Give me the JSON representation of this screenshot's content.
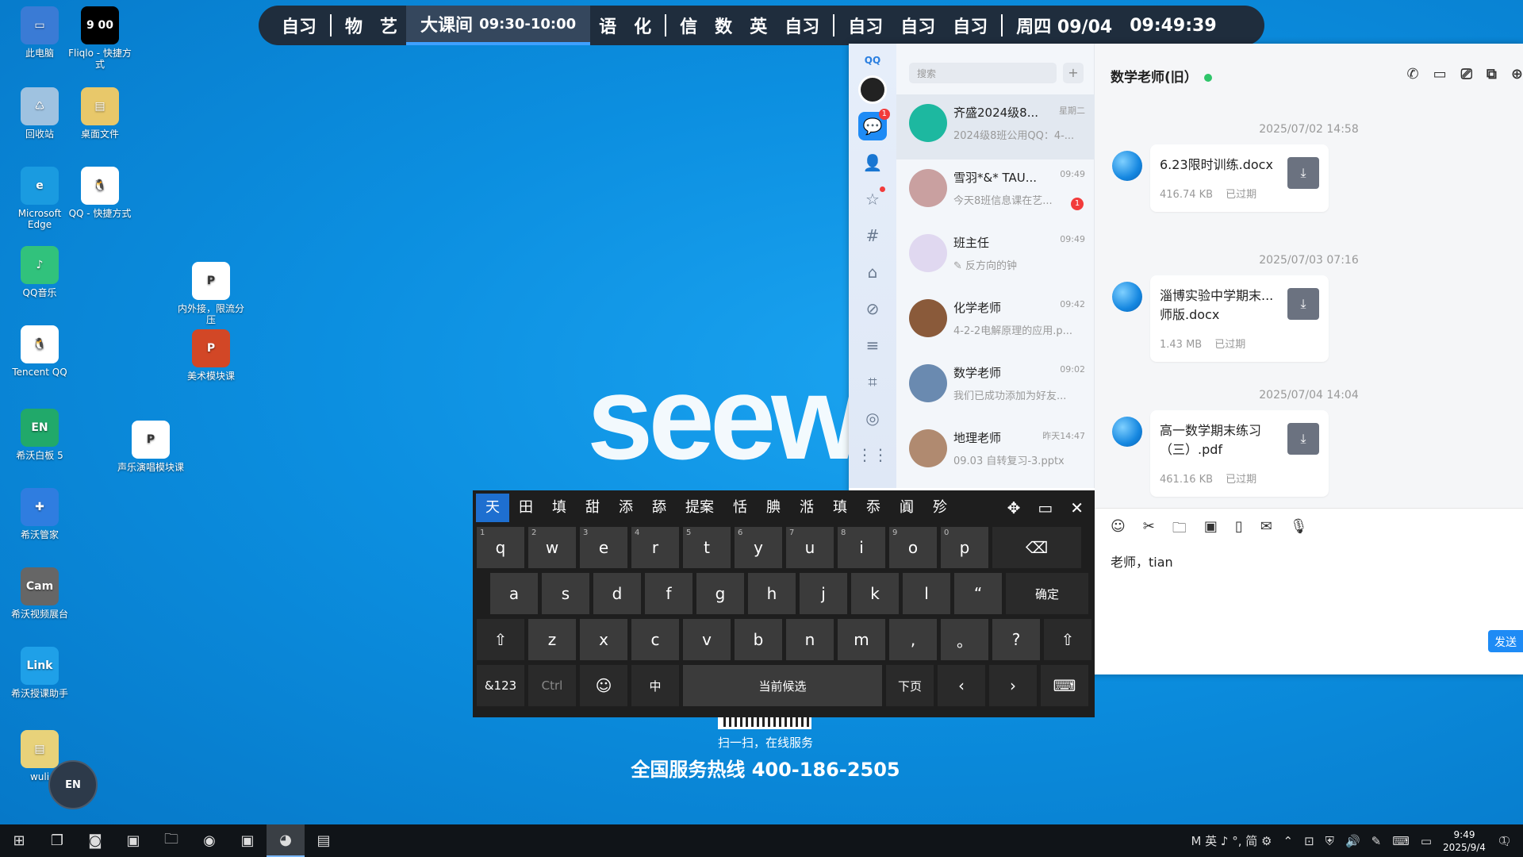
{
  "desktop": {
    "icons": [
      {
        "label": "此电脑",
        "color": "#3a7bd5",
        "glyph": "▭"
      },
      {
        "label": "Fliqlo - 快捷方式",
        "color": "#000000",
        "glyph": "9 00"
      },
      {
        "label": "回收站",
        "color": "#9fc2e0",
        "glyph": "♺"
      },
      {
        "label": "桌面文件",
        "color": "#e8c86a",
        "glyph": "▤"
      },
      {
        "label": "Microsoft Edge",
        "color": "#1a9be0",
        "glyph": "e"
      },
      {
        "label": "QQ - 快捷方式",
        "color": "#ffffff",
        "glyph": "🐧"
      },
      {
        "label": "QQ音乐",
        "color": "#31c27c",
        "glyph": "♪"
      },
      {
        "label": "内外接，限流分压",
        "color": "#ffffff",
        "glyph": "P"
      },
      {
        "label": "美术模块课",
        "color": "#d24726",
        "glyph": "P"
      },
      {
        "label": "Tencent QQ",
        "color": "#ffffff",
        "glyph": "🐧"
      },
      {
        "label": "希沃白板 5",
        "color": "#21a96a",
        "glyph": "EN"
      },
      {
        "label": "声乐演唱模块课",
        "color": "#ffffff",
        "glyph": "P"
      },
      {
        "label": "希沃管家",
        "color": "#2f7de0",
        "glyph": "✚"
      },
      {
        "label": "希沃视频展台",
        "color": "#666666",
        "glyph": "Cam"
      },
      {
        "label": "希沃授课助手",
        "color": "#1fa0e8",
        "glyph": "Link"
      },
      {
        "label": "wuli",
        "color": "#e8d27a",
        "glyph": "▤"
      }
    ],
    "brand": "seew",
    "scan_text": "扫一扫，在线服务",
    "hotline": "全国服务热线 400-186-2505",
    "floating_button": "EN"
  },
  "schedule": {
    "group1": [
      "自习"
    ],
    "group2": [
      "物",
      "艺"
    ],
    "current_label": "大课间",
    "current_time": "09:30-10:00",
    "group3": [
      "语",
      "化"
    ],
    "group4": [
      "信",
      "数",
      "英",
      "自习"
    ],
    "group5": [
      "自习",
      "自习",
      "自习"
    ],
    "date": "周四 09/04",
    "clock": "09:49:39"
  },
  "qq": {
    "logo": "QQ",
    "nav": [
      {
        "name": "messages",
        "glyph": "💬",
        "badge": "1"
      },
      {
        "name": "contacts",
        "glyph": "👤"
      },
      {
        "name": "favorites",
        "glyph": "☆"
      },
      {
        "name": "channels",
        "glyph": "#"
      },
      {
        "name": "games",
        "glyph": "⌂"
      },
      {
        "name": "link",
        "glyph": "⊘"
      },
      {
        "name": "menu",
        "glyph": "≡"
      },
      {
        "name": "store",
        "glyph": "⌗"
      },
      {
        "name": "planet",
        "glyph": "◎"
      },
      {
        "name": "apps",
        "glyph": "⋮⋮"
      }
    ],
    "search_placeholder": "搜索",
    "conversations": [
      {
        "name": "齐盛2024级8...",
        "time": "星期二",
        "msg": "2024级8班公用QQ：4-...",
        "color": "#1db8a0"
      },
      {
        "name": "雪羽*&* TAU...",
        "time": "09:49",
        "msg": "今天8班信息课在艺...",
        "color": "#c9a0a0",
        "badge": "1"
      },
      {
        "name": "班主任",
        "time": "09:49",
        "msg": "✎ 反方向的钟",
        "color": "#e0d8f0"
      },
      {
        "name": "化学老师",
        "time": "09:42",
        "msg": "4-2-2电解原理的应用.p...",
        "color": "#8a5a3a"
      },
      {
        "name": "数学老师",
        "time": "09:02",
        "msg": "我们已成功添加为好友...",
        "color": "#6a8ab0"
      },
      {
        "name": "地理老师",
        "time": "昨天14:47",
        "msg": "09.03 自转复习-3.pptx",
        "color": "#b08a70"
      }
    ],
    "chat": {
      "title": "数学老师(旧）",
      "messages": [
        {
          "time": "2025/07/02 14:58",
          "file": "6.23限时训练.docx",
          "size": "416.74 KB",
          "status": "已过期"
        },
        {
          "time": "2025/07/03 07:16",
          "file": "淄博实验中学期末...师版.docx",
          "size": "1.43 MB",
          "status": "已过期"
        },
        {
          "time": "2025/07/04 14:04",
          "file": "高一数学期末练习（三）.pdf",
          "size": "461.16 KB",
          "status": "已过期"
        }
      ],
      "input_text": "老师，tian",
      "send_label": "发送"
    }
  },
  "keyboard": {
    "candidates": [
      "天",
      "田",
      "填",
      "甜",
      "添",
      "舔",
      "提案",
      "恬",
      "腆",
      "湉",
      "瑱",
      "忝",
      "阗",
      "殄"
    ],
    "row1": [
      [
        "q",
        "1"
      ],
      [
        "w",
        "2"
      ],
      [
        "e",
        "3"
      ],
      [
        "r",
        "4"
      ],
      [
        "t",
        "5"
      ],
      [
        "y",
        "6"
      ],
      [
        "u",
        "7"
      ],
      [
        "i",
        "8"
      ],
      [
        "o",
        "9"
      ],
      [
        "p",
        "0"
      ]
    ],
    "row2": [
      "a",
      "s",
      "d",
      "f",
      "g",
      "h",
      "j",
      "k",
      "l",
      "“"
    ],
    "enter_label": "确定",
    "row3": [
      "z",
      "x",
      "c",
      "v",
      "b",
      "n",
      "m",
      ",",
      "。",
      "?"
    ],
    "sym_label": "&123",
    "ctrl_label": "Ctrl",
    "lang_label": "中",
    "space_label": "当前候选",
    "page_label": "下页"
  },
  "taskbar": {
    "tray_text": "M 英 ♪ °, 简 ⚙",
    "time": "9:49",
    "date": "2025/9/4",
    "notif_count": "1"
  }
}
